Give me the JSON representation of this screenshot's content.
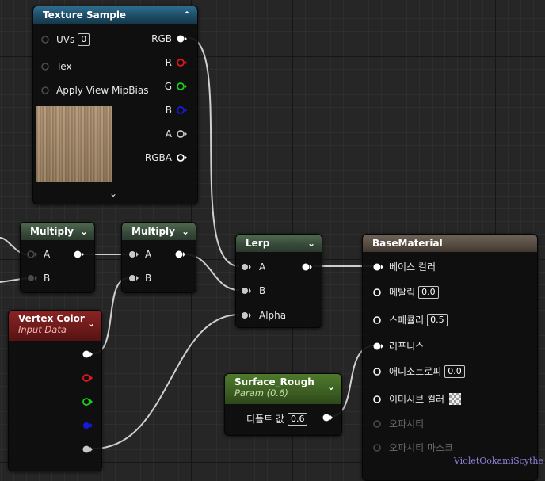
{
  "nodes": {
    "texture_sample": {
      "title": "Texture Sample",
      "inputs": [
        {
          "label": "UVs",
          "value": "0"
        },
        {
          "label": "Tex"
        },
        {
          "label": "Apply View MipBias"
        }
      ],
      "outputs": [
        "RGB",
        "R",
        "G",
        "B",
        "A",
        "RGBA"
      ]
    },
    "multiply_1": {
      "title": "Multiply",
      "inputs": [
        "A",
        "B"
      ]
    },
    "multiply_2": {
      "title": "Multiply",
      "inputs": [
        "A",
        "B"
      ]
    },
    "lerp": {
      "title": "Lerp",
      "inputs": [
        "A",
        "B",
        "Alpha"
      ]
    },
    "base_material": {
      "title": "BaseMaterial",
      "inputs": [
        {
          "label": "베이스 컬러"
        },
        {
          "label": "메탈릭",
          "value": "0.0"
        },
        {
          "label": "스페큘러",
          "value": "0.5"
        },
        {
          "label": "러프니스"
        },
        {
          "label": "애니소트로피",
          "value": "0.0"
        },
        {
          "label": "이미시브 컬러"
        },
        {
          "label": "오파시티"
        },
        {
          "label": "오파시티 마스크"
        }
      ]
    },
    "vertex_color": {
      "title": "Vertex Color",
      "subtitle": "Input Data"
    },
    "surface_rough": {
      "title": "Surface_Rough",
      "subtitle": "Param (0.6)",
      "default_label": "디폴트 값",
      "default_value": "0.6"
    }
  },
  "pin_colors": {
    "white": "#ffffff",
    "red": "#e01818",
    "green": "#18d018",
    "blue": "#1818e0",
    "gray": "#c8c8c8",
    "disabled": "#4a4a4a"
  },
  "wire_color": "#cfcfcf",
  "watermark": "VioletOokamiScythe"
}
